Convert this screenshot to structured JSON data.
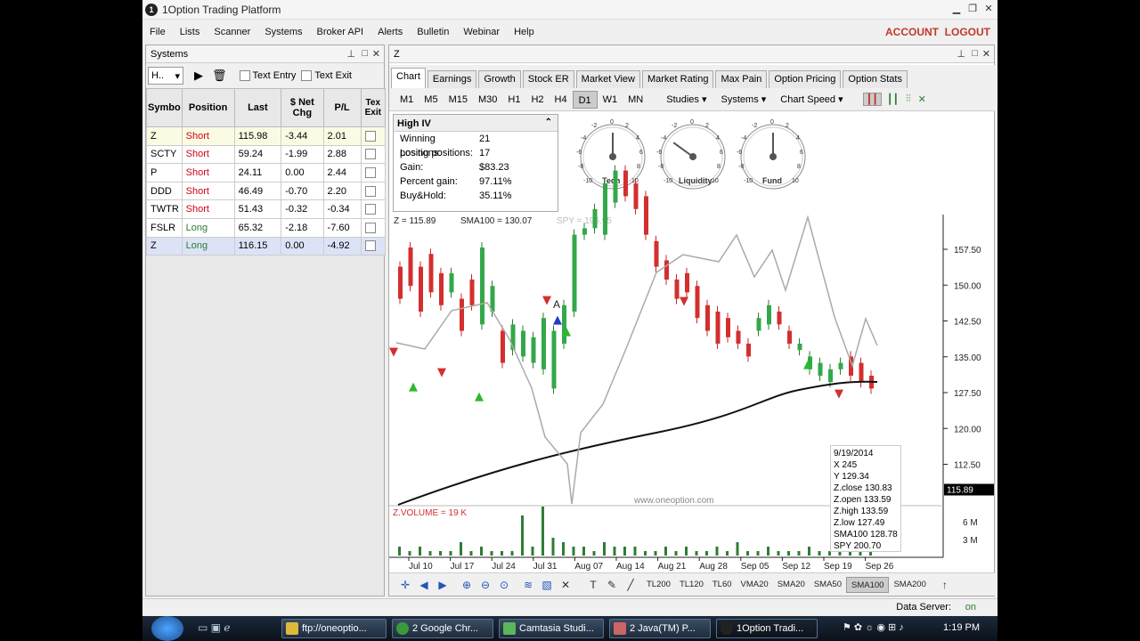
{
  "window": {
    "title": "1Option Trading Platform",
    "logo": "1"
  },
  "menu": {
    "items": [
      "File",
      "Lists",
      "Scanner",
      "Systems",
      "Broker API",
      "Alerts",
      "Bulletin",
      "Webinar",
      "Help"
    ],
    "account": "ACCOUNT",
    "logout": "LOGOUT"
  },
  "systems": {
    "title": "Systems",
    "combo": "H..",
    "text_entry": "Text Entry",
    "text_exit": "Text Exit",
    "columns": [
      "Symbo",
      "Position",
      "Last",
      "$ Net Chg",
      "P/L",
      "Tex Exit"
    ],
    "rows": [
      {
        "symbol": "Z",
        "position": "Short",
        "last": "115.98",
        "chg": "-3.44",
        "pl": "2.01"
      },
      {
        "symbol": "SCTY",
        "position": "Short",
        "last": "59.24",
        "chg": "-1.99",
        "pl": "2.88"
      },
      {
        "symbol": "P",
        "position": "Short",
        "last": "24.11",
        "chg": "0.00",
        "pl": "2.44"
      },
      {
        "symbol": "DDD",
        "position": "Short",
        "last": "46.49",
        "chg": "-0.70",
        "pl": "2.20"
      },
      {
        "symbol": "TWTR",
        "position": "Short",
        "last": "51.43",
        "chg": "-0.32",
        "pl": "-0.34"
      },
      {
        "symbol": "FSLR",
        "position": "Long",
        "last": "65.32",
        "chg": "-2.18",
        "pl": "-7.60"
      },
      {
        "symbol": "Z",
        "position": "Long",
        "last": "116.15",
        "chg": "0.00",
        "pl": "-4.92"
      }
    ]
  },
  "chart_panel": {
    "title": "Z",
    "tabs": [
      "Chart",
      "Earnings",
      "Growth",
      "Stock ER",
      "Market View",
      "Market Rating",
      "Max Pain",
      "Option Pricing",
      "Option Stats"
    ],
    "timeframes": [
      "M1",
      "M5",
      "M15",
      "M30",
      "H1",
      "H2",
      "H4",
      "D1",
      "W1",
      "MN"
    ],
    "active_timeframe": "D1",
    "dropdowns": [
      "Studies",
      "Systems",
      "Chart Speed"
    ],
    "high_iv": {
      "title": "High IV",
      "rows": [
        [
          "Winning positions:",
          "21"
        ],
        [
          "Losing positions:",
          "17"
        ],
        [
          "Gain:",
          "$83.23"
        ],
        [
          "Percent gain:",
          "97.11%"
        ],
        [
          "Buy&Hold:",
          "35.11%"
        ]
      ]
    },
    "gauges": [
      {
        "label": "Tech",
        "value": 0
      },
      {
        "label": "Liquidity",
        "value": -4
      },
      {
        "label": "Fund",
        "value": 0
      }
    ],
    "gauge_ticks": [
      "0",
      "2",
      "4",
      "6",
      "8",
      "10",
      "-2",
      "-4",
      "-6",
      "-8",
      "-10"
    ],
    "legend": {
      "price": "Z = 115.89",
      "sma": "SMA100 = 130.07",
      "spy": "SPY = 196.95"
    },
    "watermark": "www.oneoption.com",
    "marker": "A",
    "volume_label": "Z.VOLUME = 19 K",
    "y_ticks": [
      "157.50",
      "150.00",
      "142.50",
      "135.00",
      "127.50",
      "120.00",
      "112.50"
    ],
    "price_marker": "115.89",
    "vol_ticks": [
      "6 M",
      "3 M"
    ],
    "x_ticks": [
      "Jul 10",
      "Jul 17",
      "Jul 24",
      "Jul 31",
      "Aug 07",
      "Aug 14",
      "Aug 21",
      "Aug 28",
      "Sep 05",
      "Sep 12",
      "Sep 19",
      "Sep 26"
    ],
    "tooltip": [
      "9/19/2014",
      "X  245",
      "Y  129.34",
      "Z.close  130.83",
      "Z.open  133.59",
      "Z.high  133.59",
      "Z.low  127.49",
      "SMA100  128.78",
      "SPY  200.70"
    ],
    "overlay_buttons": [
      "TL200",
      "TL120",
      "TL60",
      "VMA20",
      "SMA20",
      "SMA50",
      "SMA100",
      "SMA200"
    ],
    "active_overlay": "SMA100"
  },
  "status": {
    "label": "Data Server:",
    "value": "on"
  },
  "taskbar": {
    "items": [
      "ftp://oneoptio...",
      "2 Google Chr...",
      "Camtasia Studi...",
      "2 Java(TM) P...",
      "1Option Tradi..."
    ],
    "clock": "1:19 PM"
  }
}
